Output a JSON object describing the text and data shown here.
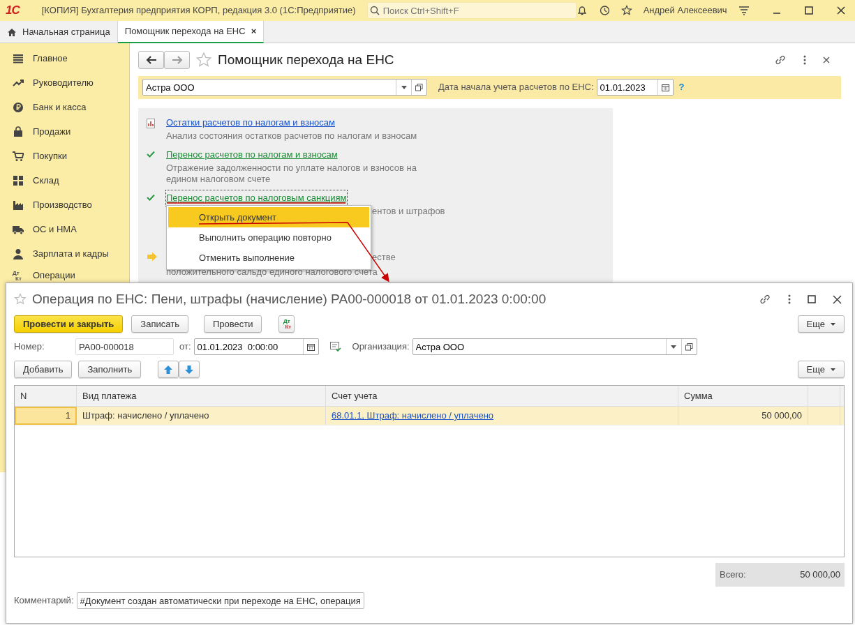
{
  "app": {
    "logo": "1С",
    "title": "[КОПИЯ] Бухгалтерия предприятия КОРП, редакция 3.0  (1С:Предприятие)",
    "search_placeholder": "Поиск Ctrl+Shift+F",
    "user": "Андрей Алексеевич"
  },
  "tabs": [
    {
      "label": "Начальная страница",
      "selected": false,
      "closable": false
    },
    {
      "label": "Помощник перехода на ЕНС",
      "selected": true,
      "closable": true
    }
  ],
  "tab_close": "×",
  "sidebar": {
    "items": [
      {
        "label": "Главное"
      },
      {
        "label": "Руководителю"
      },
      {
        "label": "Банк и касса"
      },
      {
        "label": "Продажи"
      },
      {
        "label": "Покупки"
      },
      {
        "label": "Склад"
      },
      {
        "label": "Производство"
      },
      {
        "label": "ОС и НМА"
      },
      {
        "label": "Зарплата и кадры"
      },
      {
        "label": "Операции",
        "icon_text": [
          "Дт",
          "Кт"
        ]
      }
    ]
  },
  "assistant": {
    "title": "Помощник перехода на ЕНС",
    "organization": "Астра ООО",
    "date_label": "Дата начала учета расчетов по ЕНС:",
    "date": "01.01.2023",
    "help": "?",
    "steps": [
      {
        "kind": "report",
        "link": "Остатки расчетов по налогам и взносам",
        "focused": false,
        "description": [
          "Анализ состояния остатков расчетов по налогам и взносам"
        ]
      },
      {
        "kind": "done",
        "link": "Перенос расчетов по налогам и взносам",
        "focused": false,
        "description": [
          "Отражение задолженности по уплате налогов и взносов на",
          "едином налоговом счете"
        ]
      },
      {
        "kind": "done",
        "link": "Перенос расчетов по налоговым санкциям",
        "focused": true,
        "description_tail": "ентов и штрафов"
      },
      {
        "kind": "current",
        "description_tail": "естве",
        "description": [
          "положительного сальдо единого налогового счета"
        ]
      }
    ]
  },
  "context_menu": {
    "items": [
      {
        "label": "Открыть документ",
        "selected": true
      },
      {
        "label": "Выполнить операцию повторно",
        "selected": false
      },
      {
        "label": "Отменить выполнение",
        "selected": false
      }
    ]
  },
  "document": {
    "title": "Операция по ЕНС: Пени, штрафы (начисление) РА00-000018 от 01.01.2023 0:00:00",
    "buttons": [
      {
        "label": "Провести и закрыть",
        "kind": "primary"
      },
      {
        "label": "Записать",
        "kind": "default"
      },
      {
        "label": "Провести",
        "kind": "default"
      }
    ],
    "dtkt": [
      "Дт",
      "Кт"
    ],
    "more": "Еще",
    "number_label": "Номер:",
    "number": "РА00-000018",
    "date_label": "от:",
    "date": "01.01.2023  0:00:00",
    "org_label": "Организация:",
    "organization": "Астра ООО",
    "table_buttons": [
      "Добавить",
      "Заполнить"
    ],
    "table_more": "Еще",
    "table": {
      "columns": [
        "N",
        "Вид платежа",
        "Счет учета",
        "Сумма"
      ],
      "rows": [
        {
          "selected": true,
          "cells": [
            "1",
            "Штраф: начислено / уплачено",
            "68.01.1, Штраф: начислено / уплачено",
            "50 000,00"
          ]
        }
      ]
    },
    "total_label": "Всего:",
    "total": "50 000,00",
    "comment_label": "Комментарий:",
    "comment": "#Документ создан автоматически при переходе на ЕНС, операция"
  }
}
